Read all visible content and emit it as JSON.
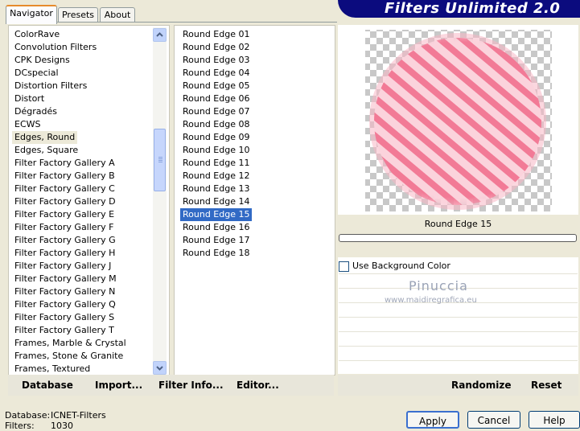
{
  "tabs": [
    {
      "label": "Navigator",
      "active": true
    },
    {
      "label": "Presets",
      "active": false
    },
    {
      "label": "About",
      "active": false
    }
  ],
  "header": {
    "title": "Filters Unlimited 2.0"
  },
  "categories": [
    "ColorRave",
    "Convolution Filters",
    "CPK Designs",
    "DCspecial",
    "Distortion Filters",
    "Distort",
    "Dégradés",
    "ECWS",
    "Edges, Round",
    "Edges, Square",
    "Filter Factory Gallery A",
    "Filter Factory Gallery B",
    "Filter Factory Gallery C",
    "Filter Factory Gallery D",
    "Filter Factory Gallery E",
    "Filter Factory Gallery F",
    "Filter Factory Gallery G",
    "Filter Factory Gallery H",
    "Filter Factory Gallery J",
    "Filter Factory Gallery M",
    "Filter Factory Gallery N",
    "Filter Factory Gallery Q",
    "Filter Factory Gallery S",
    "Filter Factory Gallery T",
    "Frames, Marble & Crystal",
    "Frames, Stone & Granite",
    "Frames, Textured"
  ],
  "selected_category": "Edges, Round",
  "filters": [
    "Round Edge 01",
    "Round Edge 02",
    "Round Edge 03",
    "Round Edge 04",
    "Round Edge 05",
    "Round Edge 06",
    "Round Edge 07",
    "Round Edge 08",
    "Round Edge 09",
    "Round Edge 10",
    "Round Edge 11",
    "Round Edge 12",
    "Round Edge 13",
    "Round Edge 14",
    "Round Edge 15",
    "Round Edge 16",
    "Round Edge 17",
    "Round Edge 18"
  ],
  "selected_filter": "Round Edge 15",
  "preview": {
    "filter_name": "Round Edge 15",
    "progress": 0
  },
  "options": {
    "use_background_color_label": "Use Background Color",
    "use_background_color_checked": false
  },
  "watermark": {
    "name": "Pinuccia",
    "url": "www.maidiregrafica.eu"
  },
  "left_buttons": {
    "database": "Database",
    "import": "Import...",
    "filter_info": "Filter Info...",
    "editor": "Editor..."
  },
  "right_buttons": {
    "randomize": "Randomize",
    "reset": "Reset"
  },
  "status": {
    "database_label": "Database:",
    "database_value": "ICNET-Filters",
    "filters_label": "Filters:",
    "filters_value": "1030"
  },
  "dialog_buttons": {
    "apply": "Apply",
    "cancel": "Cancel",
    "help": "Help"
  },
  "colors": {
    "accent_blue": "#316ac5",
    "banner": "#0b0b7e",
    "stripe_pink": "#f07090"
  }
}
